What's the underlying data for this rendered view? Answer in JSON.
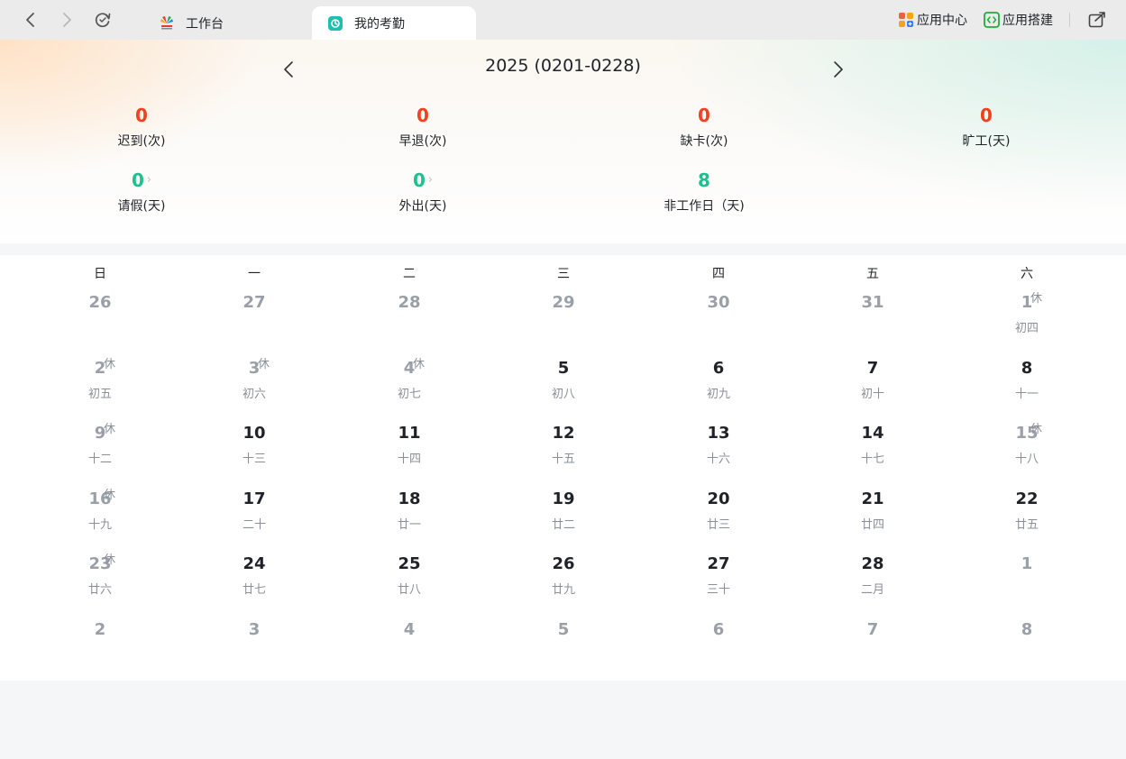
{
  "topbar": {
    "tabs": [
      {
        "label": "工作台",
        "active": false
      },
      {
        "label": "我的考勤",
        "active": true
      }
    ],
    "app_center_label": "应用中心",
    "app_builder_label": "应用搭建"
  },
  "summary": {
    "month_title": "2025 (0201-0228)",
    "stats": [
      {
        "value": "0",
        "label": "迟到(次)",
        "color": "red",
        "has_chevron": false
      },
      {
        "value": "0",
        "label": "早退(次)",
        "color": "red",
        "has_chevron": false
      },
      {
        "value": "0",
        "label": "缺卡(次)",
        "color": "red",
        "has_chevron": false
      },
      {
        "value": "0",
        "label": "旷工(天)",
        "color": "red",
        "has_chevron": false
      },
      {
        "value": "0",
        "label": "请假(天)",
        "color": "green",
        "has_chevron": true
      },
      {
        "value": "0",
        "label": "外出(天)",
        "color": "green",
        "has_chevron": true
      },
      {
        "value": "8",
        "label": "非工作日（天)",
        "color": "green",
        "has_chevron": false
      }
    ]
  },
  "calendar": {
    "weekdays": [
      "日",
      "一",
      "二",
      "三",
      "四",
      "五",
      "六"
    ],
    "rest_label": "休",
    "weeks": [
      [
        {
          "day": "26",
          "lunar": "",
          "current": false,
          "rest": false
        },
        {
          "day": "27",
          "lunar": "",
          "current": false,
          "rest": false
        },
        {
          "day": "28",
          "lunar": "",
          "current": false,
          "rest": false
        },
        {
          "day": "29",
          "lunar": "",
          "current": false,
          "rest": false
        },
        {
          "day": "30",
          "lunar": "",
          "current": false,
          "rest": false
        },
        {
          "day": "31",
          "lunar": "",
          "current": false,
          "rest": false
        },
        {
          "day": "1",
          "lunar": "初四",
          "current": false,
          "rest": true
        }
      ],
      [
        {
          "day": "2",
          "lunar": "初五",
          "current": false,
          "rest": true
        },
        {
          "day": "3",
          "lunar": "初六",
          "current": false,
          "rest": true
        },
        {
          "day": "4",
          "lunar": "初七",
          "current": false,
          "rest": true
        },
        {
          "day": "5",
          "lunar": "初八",
          "current": true,
          "rest": false
        },
        {
          "day": "6",
          "lunar": "初九",
          "current": true,
          "rest": false
        },
        {
          "day": "7",
          "lunar": "初十",
          "current": true,
          "rest": false
        },
        {
          "day": "8",
          "lunar": "十一",
          "current": true,
          "rest": false
        }
      ],
      [
        {
          "day": "9",
          "lunar": "十二",
          "current": false,
          "rest": true
        },
        {
          "day": "10",
          "lunar": "十三",
          "current": true,
          "rest": false
        },
        {
          "day": "11",
          "lunar": "十四",
          "current": true,
          "rest": false
        },
        {
          "day": "12",
          "lunar": "十五",
          "current": true,
          "rest": false
        },
        {
          "day": "13",
          "lunar": "十六",
          "current": true,
          "rest": false
        },
        {
          "day": "14",
          "lunar": "十七",
          "current": true,
          "rest": false
        },
        {
          "day": "15",
          "lunar": "十八",
          "current": false,
          "rest": true
        }
      ],
      [
        {
          "day": "16",
          "lunar": "十九",
          "current": false,
          "rest": true
        },
        {
          "day": "17",
          "lunar": "二十",
          "current": true,
          "rest": false
        },
        {
          "day": "18",
          "lunar": "廿一",
          "current": true,
          "rest": false
        },
        {
          "day": "19",
          "lunar": "廿二",
          "current": true,
          "rest": false
        },
        {
          "day": "20",
          "lunar": "廿三",
          "current": true,
          "rest": false
        },
        {
          "day": "21",
          "lunar": "廿四",
          "current": true,
          "rest": false
        },
        {
          "day": "22",
          "lunar": "廿五",
          "current": true,
          "rest": false
        }
      ],
      [
        {
          "day": "23",
          "lunar": "廿六",
          "current": false,
          "rest": true
        },
        {
          "day": "24",
          "lunar": "廿七",
          "current": true,
          "rest": false
        },
        {
          "day": "25",
          "lunar": "廿八",
          "current": true,
          "rest": false
        },
        {
          "day": "26",
          "lunar": "廿九",
          "current": true,
          "rest": false
        },
        {
          "day": "27",
          "lunar": "三十",
          "current": true,
          "rest": false
        },
        {
          "day": "28",
          "lunar": "二月",
          "current": true,
          "rest": false
        },
        {
          "day": "1",
          "lunar": "",
          "current": false,
          "rest": false
        }
      ],
      [
        {
          "day": "2",
          "lunar": "",
          "current": false,
          "rest": false
        },
        {
          "day": "3",
          "lunar": "",
          "current": false,
          "rest": false
        },
        {
          "day": "4",
          "lunar": "",
          "current": false,
          "rest": false
        },
        {
          "day": "5",
          "lunar": "",
          "current": false,
          "rest": false
        },
        {
          "day": "6",
          "lunar": "",
          "current": false,
          "rest": false
        },
        {
          "day": "7",
          "lunar": "",
          "current": false,
          "rest": false
        },
        {
          "day": "8",
          "lunar": "",
          "current": false,
          "rest": false
        }
      ]
    ]
  },
  "colors": {
    "late_red": "#f53f1f",
    "leave_green": "#1fbf8f",
    "tab_icon_teal": "#1fbfb0"
  }
}
